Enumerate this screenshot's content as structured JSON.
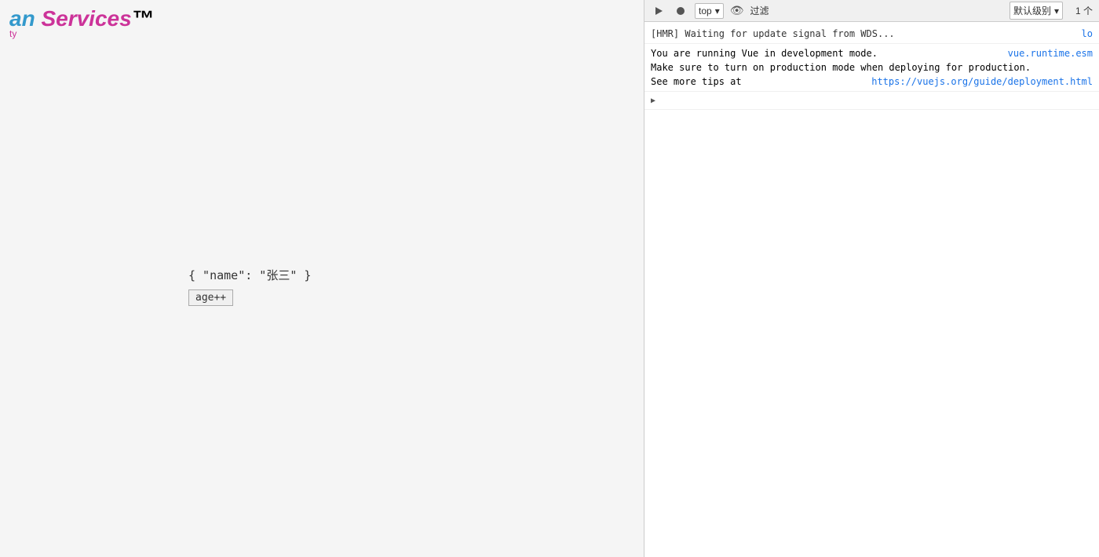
{
  "app": {
    "logo": {
      "an": "an",
      "services": " Services",
      "subtitle": "ty"
    },
    "json_display": "{ \"name\": \"张三\" }",
    "age_button_label": "age++"
  },
  "devtools": {
    "toolbar": {
      "play_icon": "▶",
      "stop_icon": "⊘",
      "top_label": "top",
      "eye_icon": "👁",
      "filter_label": "过滤",
      "default_level_label": "默认级别",
      "count_label": "1 个"
    },
    "console_lines": [
      {
        "id": 1,
        "type": "hmr",
        "text": "[HMR] Waiting for update signal from WDS...",
        "source": "lo",
        "expandable": false
      },
      {
        "id": 2,
        "type": "vue-warning",
        "text_main": "You are running Vue in development mode.",
        "text_line2": "Make sure to turn on production mode when deploying for production.",
        "text_line3": "See more tips at ",
        "link_text": "https://vuejs.org/guide/deployment.html",
        "link_href": "https://vuejs.org/guide/deployment.html",
        "source": "vue.runtime.esm",
        "expandable": false
      },
      {
        "id": 3,
        "type": "expandable",
        "text": ">",
        "expandable": true
      }
    ]
  }
}
